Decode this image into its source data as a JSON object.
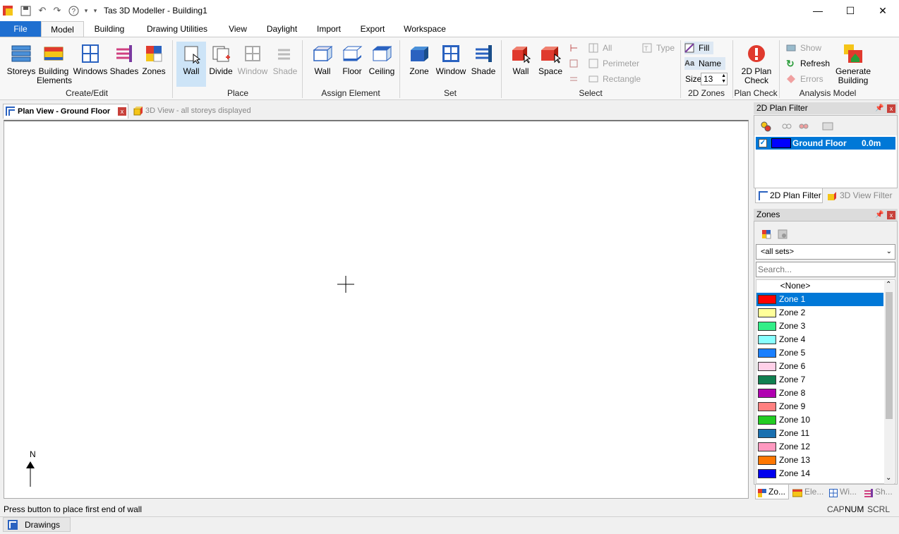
{
  "app": {
    "title": "Tas 3D Modeller - Building1"
  },
  "menu_tabs": [
    "File",
    "Model",
    "Building",
    "Drawing Utilities",
    "View",
    "Daylight",
    "Import",
    "Export",
    "Workspace"
  ],
  "ribbon": {
    "create_edit": {
      "group": "Create/Edit",
      "storeys": "Storeys",
      "building_elements_1": "Building",
      "building_elements_2": "Elements",
      "windows": "Windows",
      "shades": "Shades",
      "zones": "Zones"
    },
    "place": {
      "group": "Place",
      "wall": "Wall",
      "divide": "Divide",
      "window": "Window",
      "shade": "Shade"
    },
    "assign": {
      "group": "Assign Element",
      "wall": "Wall",
      "floor": "Floor",
      "ceiling": "Ceiling"
    },
    "set": {
      "group": "Set",
      "zone": "Zone",
      "window": "Window",
      "shade": "Shade"
    },
    "select": {
      "group": "Select",
      "wall": "Wall",
      "space": "Space",
      "all": "All",
      "perimeter": "Perimeter",
      "rectangle": "Rectangle",
      "type": "Type"
    },
    "zones2d": {
      "group": "2D Zones",
      "fill": "Fill",
      "name": "Name",
      "size_label": "Size",
      "size_value": "13"
    },
    "plan_check": {
      "group": "Plan Check",
      "btn1": "2D Plan",
      "btn2": "Check"
    },
    "analysis": {
      "group": "Analysis Model",
      "show": "Show",
      "refresh": "Refresh",
      "errors": "Errors",
      "gen1": "Generate",
      "gen2": "Building"
    }
  },
  "doc_tabs": {
    "plan": "Plan View - Ground Floor",
    "view3d": "3D View - all storeys displayed"
  },
  "canvas": {
    "north": "N"
  },
  "plan_filter": {
    "title": "2D Plan Filter",
    "row_name": "Ground Floor",
    "row_value": "0.0m",
    "tab_2d": "2D Plan Filter",
    "tab_3d": "3D View Filter"
  },
  "zones_panel": {
    "title": "Zones",
    "set_select": "<all sets>",
    "search_placeholder": "Search...",
    "none_item": "<None>",
    "items": [
      {
        "name": "Zone 1",
        "color": "#ff0000"
      },
      {
        "name": "Zone 2",
        "color": "#ffff99"
      },
      {
        "name": "Zone 3",
        "color": "#33ee88"
      },
      {
        "name": "Zone 4",
        "color": "#88ffff"
      },
      {
        "name": "Zone 5",
        "color": "#1a7fff"
      },
      {
        "name": "Zone 6",
        "color": "#ffd0e8"
      },
      {
        "name": "Zone 7",
        "color": "#108050"
      },
      {
        "name": "Zone 8",
        "color": "#b000b0"
      },
      {
        "name": "Zone 9",
        "color": "#ff8080"
      },
      {
        "name": "Zone 10",
        "color": "#22cc22"
      },
      {
        "name": "Zone 11",
        "color": "#1a70b0"
      },
      {
        "name": "Zone 12",
        "color": "#ff99c0"
      },
      {
        "name": "Zone 13",
        "color": "#ff7700"
      },
      {
        "name": "Zone 14",
        "color": "#0000ee"
      }
    ],
    "bottom_tabs": [
      "Zo...",
      "Ele...",
      "Wi...",
      "Sh..."
    ]
  },
  "status": {
    "message": "Press button to place first end of wall",
    "cap": "CAP",
    "num": "NUM",
    "scrl": "SCRL"
  },
  "bottom": {
    "drawings": "Drawings"
  }
}
